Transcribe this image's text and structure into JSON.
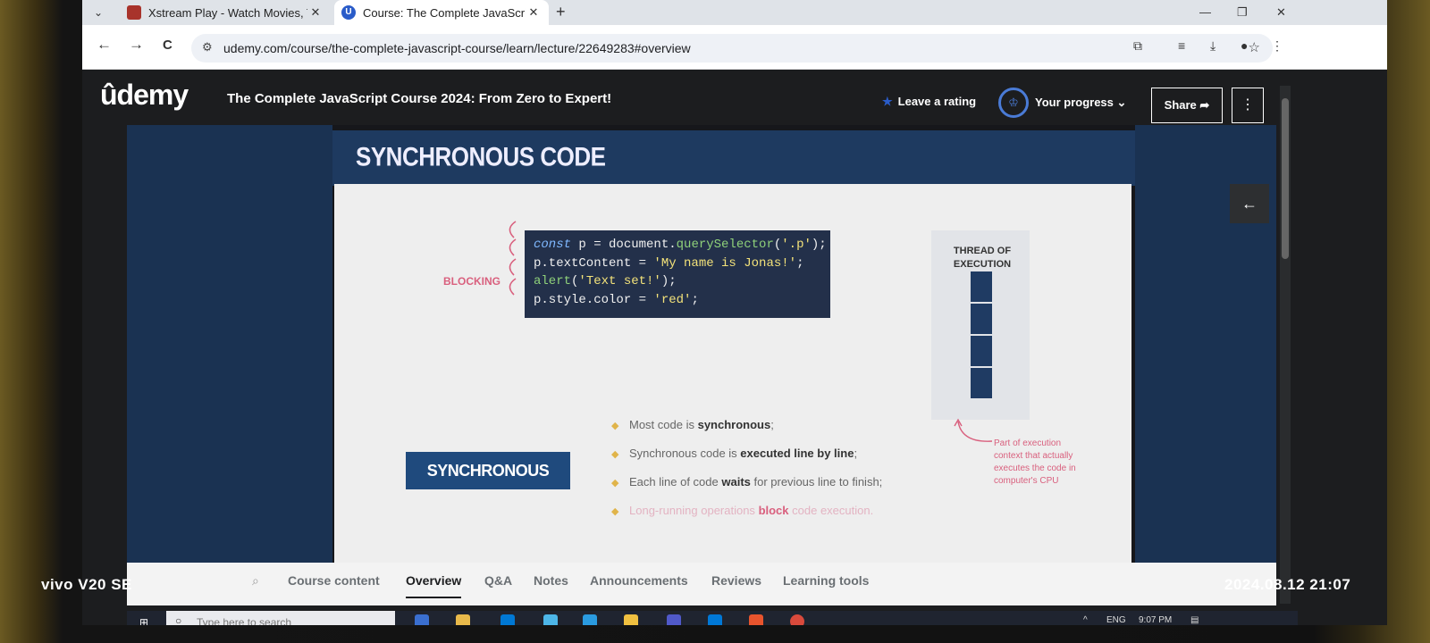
{
  "browser": {
    "tabs": [
      {
        "title": "Xstream Play - Watch Movies, T",
        "close": "✕"
      },
      {
        "title": "Course: The Complete JavaScrip",
        "close": "✕"
      }
    ],
    "new_tab": "+",
    "window_controls": {
      "minimize": "—",
      "restore": "❐",
      "close": "✕"
    },
    "nav": {
      "back": "←",
      "forward": "→",
      "reload": "C"
    },
    "url": "udemy.com/course/the-complete-javascript-course/learn/lecture/22649283#overview"
  },
  "header": {
    "logo": "ûdemy",
    "course_title": "The Complete JavaScript Course 2024: From Zero to Expert!",
    "rating_label": "Leave a rating",
    "progress_label": "Your progress",
    "share_label": "Share",
    "more_label": "⋮"
  },
  "slide": {
    "heading": "SYNCHRONOUS CODE",
    "code_lines": [
      "const p = document.querySelector('.p');",
      "p.textContent = 'My name is Jonas!';",
      "alert('Text set!');",
      "p.style.color = 'red';"
    ],
    "blocking_label": "BLOCKING",
    "thread_label": "THREAD OF EXECUTION",
    "badge": "SYNCHRONOUS",
    "bullets": [
      {
        "pre": "Most code is ",
        "bold": "synchronous",
        "post": ";"
      },
      {
        "pre": "Synchronous code is ",
        "bold": "executed line by line",
        "post": ";"
      },
      {
        "pre": "Each line of code ",
        "bold": "waits",
        "post": " for previous line to finish;"
      },
      {
        "pre": "Long-running operations ",
        "bold": "block",
        "post": " code execution."
      }
    ],
    "exec_note": "Part of execution context that actually executes the code in computer's CPU"
  },
  "course_tabs": {
    "items": [
      "Course content",
      "Overview",
      "Q&A",
      "Notes",
      "Announcements",
      "Reviews",
      "Learning tools"
    ],
    "active": "Overview"
  },
  "taskbar": {
    "search_placeholder": "Type here to search",
    "lang": "ENG",
    "time": "9:07 PM"
  },
  "watermark": {
    "device": "vivo V20 SE",
    "datetime": "2024.08.12 21:07"
  },
  "colors": {
    "udemy_dark": "#1c1d1f",
    "slide_navy": "#1e3a60",
    "accent_pink": "#d9607e",
    "accent_blue": "#4a7bd6"
  }
}
